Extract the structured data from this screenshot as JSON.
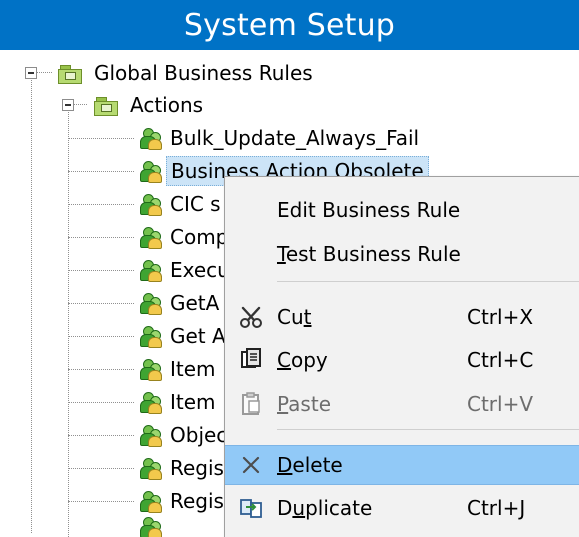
{
  "window": {
    "title": "System Setup"
  },
  "tree": {
    "root": {
      "label": "Global Business Rules"
    },
    "actions_folder": {
      "label": "Actions"
    },
    "items": [
      {
        "label": "Bulk_Update_Always_Fail"
      },
      {
        "label": "Business Action Obsolete"
      },
      {
        "label": "CIC s"
      },
      {
        "label": "Comp"
      },
      {
        "label": "Execu"
      },
      {
        "label": "GetA"
      },
      {
        "label": "Get A"
      },
      {
        "label": "Item"
      },
      {
        "label": "Item"
      },
      {
        "label": "Objec"
      },
      {
        "label": "Regis"
      },
      {
        "label": "Regis"
      }
    ]
  },
  "context_menu": {
    "items": [
      {
        "label": "Edit Business Rule",
        "icon": "",
        "shortcut": ""
      },
      {
        "label_prefix": "",
        "label_underlined": "T",
        "label_suffix": "est Business Rule",
        "icon": "",
        "shortcut": ""
      },
      {
        "label_prefix": "Cu",
        "label_underlined": "t",
        "label_suffix": "",
        "icon": "scissors-icon",
        "shortcut": "Ctrl+X"
      },
      {
        "label_prefix": "",
        "label_underlined": "C",
        "label_suffix": "opy",
        "icon": "copy-icon",
        "shortcut": "Ctrl+C"
      },
      {
        "label_prefix": "",
        "label_underlined": "P",
        "label_suffix": "aste",
        "icon": "paste-icon",
        "shortcut": "Ctrl+V",
        "disabled": true
      },
      {
        "label_prefix": "",
        "label_underlined": "D",
        "label_suffix": "elete",
        "icon": "delete-icon",
        "shortcut": "",
        "hovered": true
      },
      {
        "label_prefix": "D",
        "label_underlined": "u",
        "label_suffix": "plicate",
        "icon": "duplicate-icon",
        "shortcut": "Ctrl+J"
      }
    ]
  },
  "colors": {
    "title_bar": "#0072c6",
    "selection": "#cce4f7",
    "menu_background": "#f2f2f2",
    "menu_hover": "#91c9f7"
  }
}
